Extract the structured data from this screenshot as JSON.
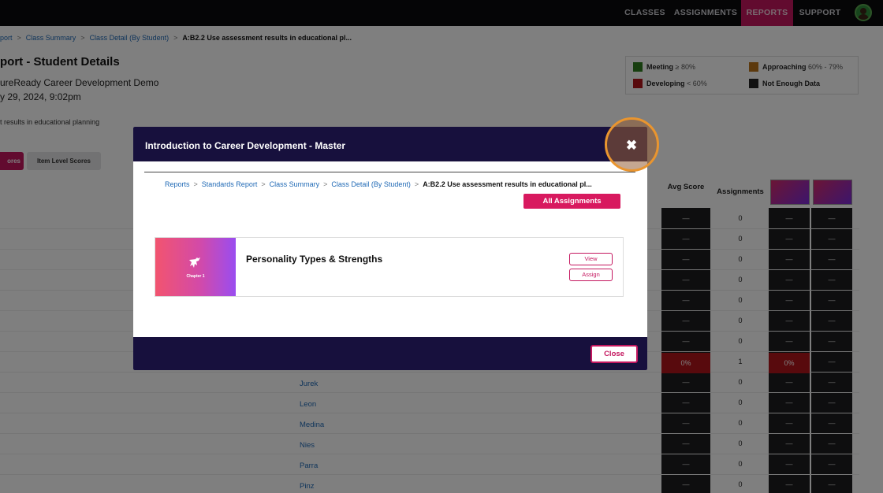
{
  "nav": {
    "classes": "CLASSES",
    "assignments": "ASSIGNMENTS",
    "reports": "REPORTS",
    "support": "SUPPORT"
  },
  "background": {
    "breadcrumb": {
      "item1": "port",
      "item2": "Class Summary",
      "item3": "Class Detail (By Student)",
      "current": "A:B2.2 Use assessment results in educational pl..."
    },
    "title": "port - Student Details",
    "subtitle": "ureReady Career Development Demo",
    "date": "y 29, 2024, 9:02pm",
    "description": "t results in educational planning",
    "tab_scores": "ores",
    "tab_item_level": "Item Level Scores",
    "legend": {
      "meeting": "Meeting",
      "meeting_range": "≥ 80%",
      "approaching": "Approaching",
      "approaching_range": "60% - 79%",
      "developing": "Developing",
      "developing_range": "< 60%",
      "not_enough": "Not Enough Data",
      "colors": {
        "meeting": "#2e7d1f",
        "approaching": "#b8731a",
        "developing": "#b0141a",
        "not_enough": "#222222"
      }
    },
    "table": {
      "col_avg": "Avg Score",
      "col_assignments": "Assignments",
      "dash": "—",
      "red_value": "0%",
      "assign_counts": [
        "0",
        "0",
        "0",
        "0",
        "0",
        "0",
        "0",
        "1",
        "0",
        "0",
        "0",
        "0",
        "0",
        "0"
      ],
      "names": [
        "Jurek",
        "Leon",
        "Medina",
        "Nies",
        "Parra",
        "Pinz"
      ]
    }
  },
  "modal": {
    "title": "Introduction to Career Development - Master",
    "breadcrumb": {
      "reports": "Reports",
      "standards": "Standards Report",
      "class_summary": "Class Summary",
      "class_detail": "Class Detail (By Student)",
      "current": "A:B2.2 Use assessment results in educational pl..."
    },
    "all_assignments": "All Assignments",
    "card": {
      "chapter": "Chapter 1",
      "title": "Personality Types & Strengths",
      "view": "View",
      "assign": "Assign"
    },
    "close_button": "Close",
    "close_icon": "✖"
  },
  "colors": {
    "brand_pink": "#c4175f",
    "modal_header": "#17103d",
    "highlight": "#e9952f"
  }
}
